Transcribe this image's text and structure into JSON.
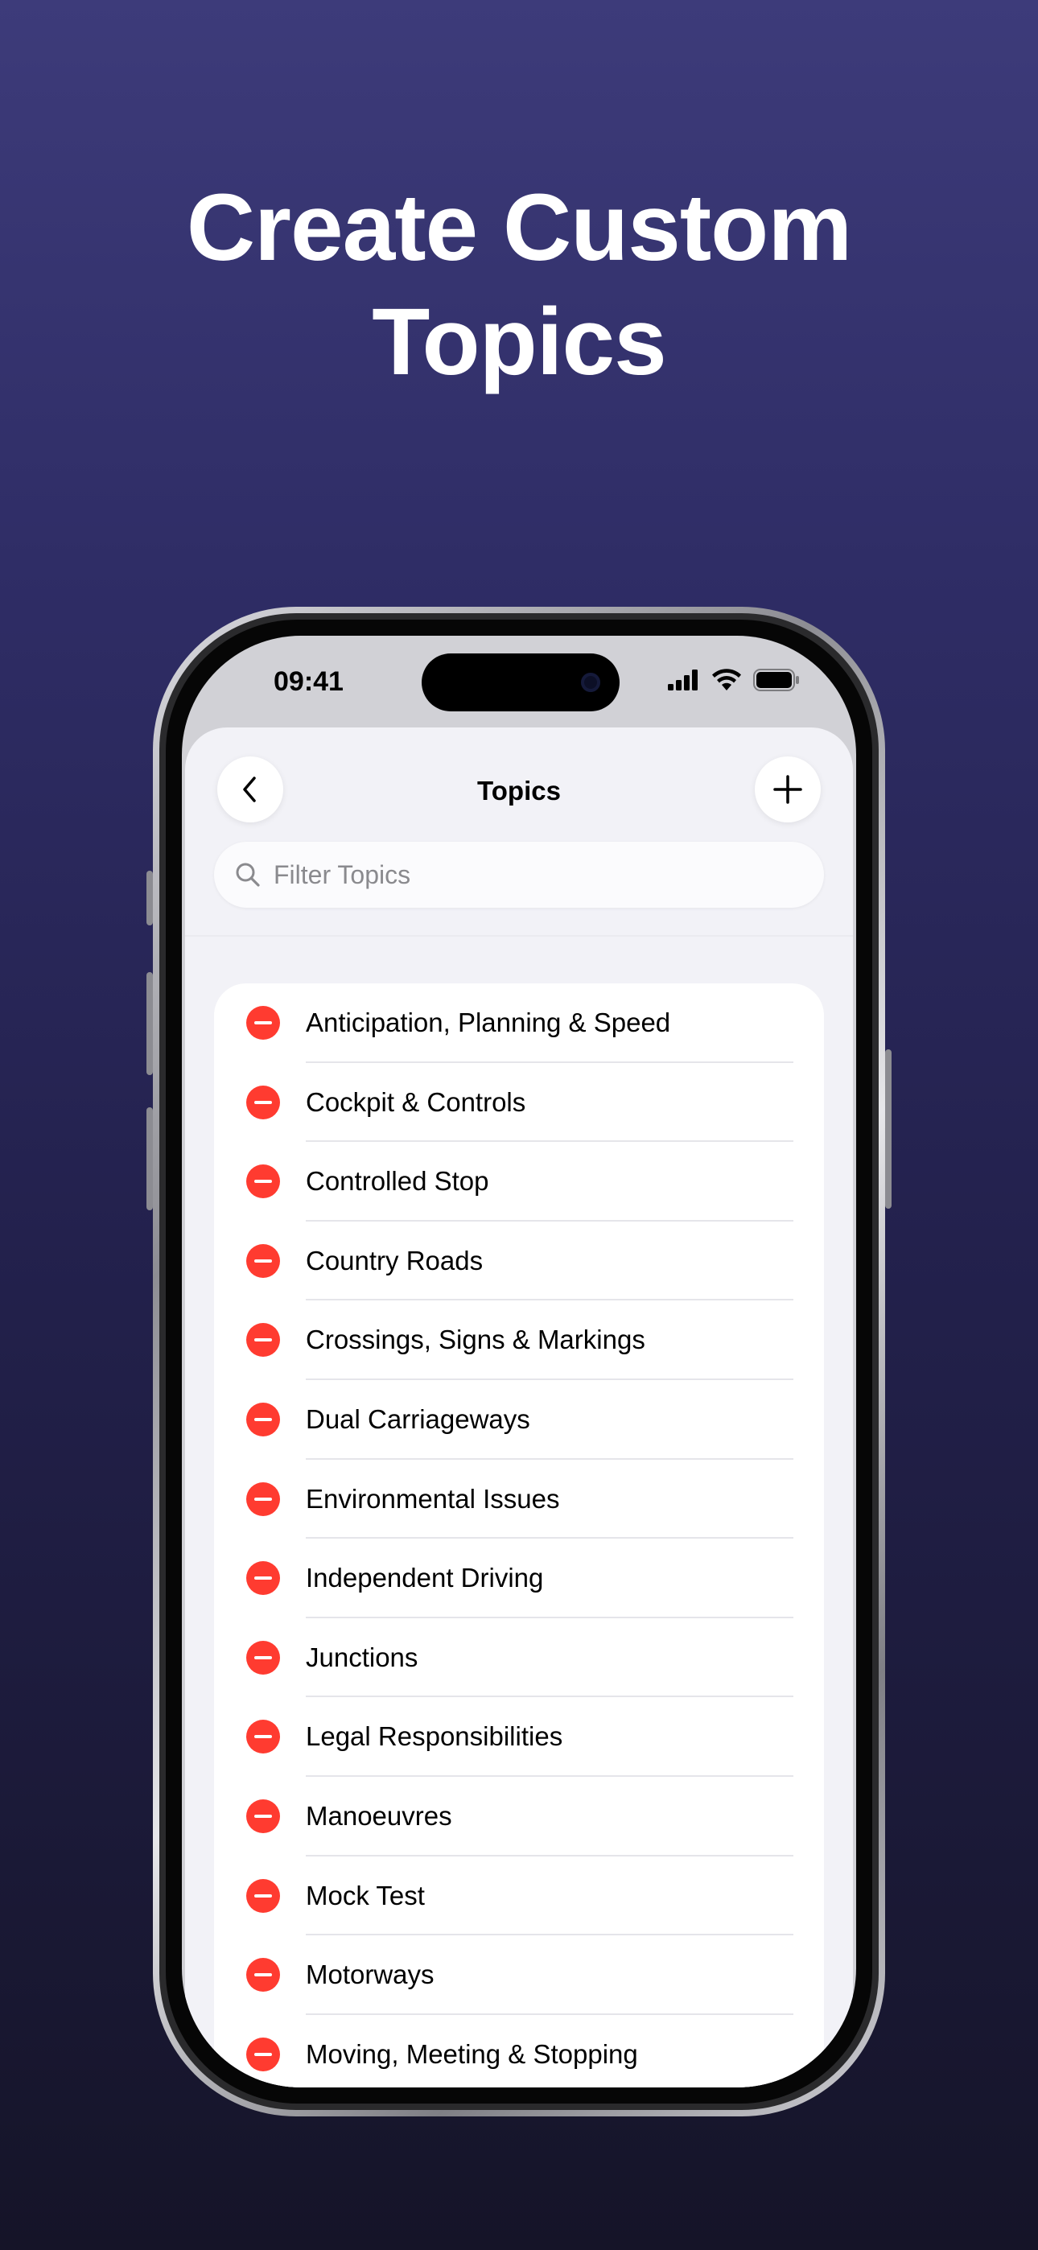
{
  "headline": {
    "line1": "Create Custom",
    "line2": "Topics"
  },
  "status_bar": {
    "time": "09:41"
  },
  "nav": {
    "title": "Topics",
    "back_icon": "chevron-left-icon",
    "add_icon": "plus-icon"
  },
  "search": {
    "placeholder": "Filter Topics"
  },
  "topics": [
    "Anticipation, Planning & Speed",
    "Cockpit & Controls",
    "Controlled Stop",
    "Country Roads",
    "Crossings, Signs & Markings",
    "Dual Carriageways",
    "Environmental Issues",
    "Independent Driving",
    "Junctions",
    "Legal Responsibilities",
    "Manoeuvres",
    "Mock Test",
    "Motorways",
    "Moving, Meeting & Stopping"
  ],
  "colors": {
    "delete": "#ff3b30",
    "background_top": "#3d3b7a",
    "background_bottom": "#151428"
  }
}
